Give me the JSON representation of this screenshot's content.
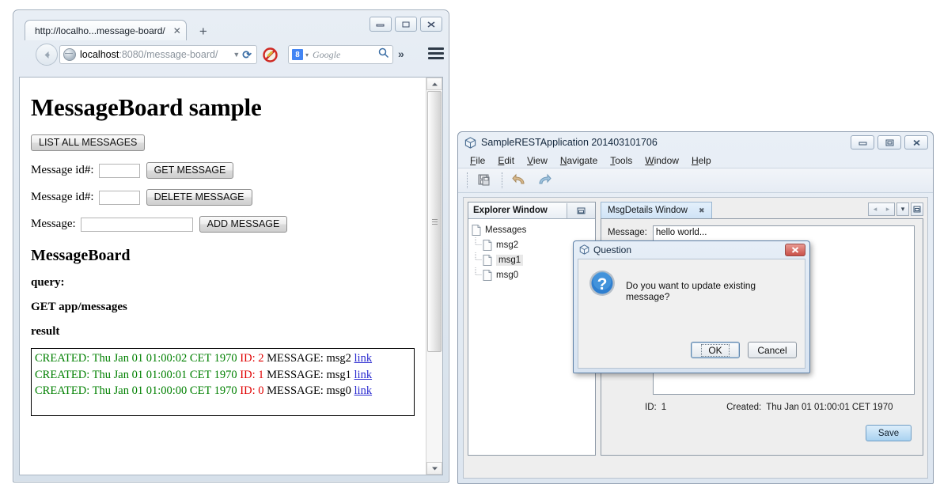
{
  "browser": {
    "tab": {
      "label": "http://localho...message-board/",
      "close": "✕",
      "new_tab": "+"
    },
    "window_buttons": {
      "minimize": "minimize-icon",
      "maximize": "maximize-icon",
      "close": "close-icon"
    },
    "url": {
      "host": "localhost",
      "path": ":8080/message-board/",
      "dropdown": "▼",
      "reload": "⟳"
    },
    "search": {
      "engine_badge": "8",
      "caret": "▾",
      "placeholder_text": "Google",
      "magnifier": "search-icon"
    },
    "overflow": "»",
    "menu": "hamburger-menu-icon",
    "noscript": "noscript-blocked-icon"
  },
  "page": {
    "title": "MessageBoard sample",
    "list_all_button": "LIST ALL MESSAGES",
    "rows": [
      {
        "label": "Message id#:",
        "value": "",
        "button": "GET MESSAGE",
        "wide": false
      },
      {
        "label": "Message id#:",
        "value": "",
        "button": "DELETE MESSAGE",
        "wide": false
      },
      {
        "label": "Message:",
        "value": "",
        "button": "ADD MESSAGE",
        "wide": true
      }
    ],
    "section_title": "MessageBoard",
    "query_label": "query:",
    "query_value": "GET app/messages",
    "result_label": "result",
    "results": [
      {
        "created_label": "CREATED:",
        "created": "Thu Jan 01 01:00:02 CET 1970",
        "id_label": "ID:",
        "id": "2",
        "message_label": "MESSAGE:",
        "message": "msg2",
        "link": "link"
      },
      {
        "created_label": "CREATED:",
        "created": "Thu Jan 01 01:00:01 CET 1970",
        "id_label": "ID:",
        "id": "1",
        "message_label": "MESSAGE:",
        "message": "msg1",
        "link": "link"
      },
      {
        "created_label": "CREATED:",
        "created": "Thu Jan 01 01:00:00 CET 1970",
        "id_label": "ID:",
        "id": "0",
        "message_label": "MESSAGE:",
        "message": "msg0",
        "link": "link"
      }
    ],
    "colors": {
      "created": "#008000",
      "id": "#e00000",
      "link": "#2a2ad0"
    }
  },
  "app": {
    "title": "SampleRESTApplication 201403101706",
    "menus": [
      {
        "pre": "",
        "mnemonic": "F",
        "post": "ile"
      },
      {
        "pre": "",
        "mnemonic": "E",
        "post": "dit"
      },
      {
        "pre": "",
        "mnemonic": "V",
        "post": "iew"
      },
      {
        "pre": "",
        "mnemonic": "N",
        "post": "avigate"
      },
      {
        "pre": "",
        "mnemonic": "T",
        "post": "ools"
      },
      {
        "pre": "",
        "mnemonic": "W",
        "post": "indow"
      },
      {
        "pre": "",
        "mnemonic": "H",
        "post": "elp"
      }
    ],
    "toolbar": [
      "save-all-icon",
      "undo-icon",
      "redo-icon"
    ],
    "explorer": {
      "title": "Explorer Window",
      "minimize": "▭",
      "root": "Messages",
      "children": [
        {
          "label": "msg2",
          "selected": false
        },
        {
          "label": "msg1",
          "selected": true
        },
        {
          "label": "msg0",
          "selected": false
        }
      ]
    },
    "editor": {
      "tab_label": "MsgDetails Window",
      "tab_close": "✖",
      "message_label": "Message:",
      "message_value": "hello world...",
      "id_label": "ID:",
      "id_value": "1",
      "created_label": "Created:",
      "created_value": "Thu Jan 01 01:00:01 CET 1970",
      "save_label": "Save",
      "nav_prev": "◂",
      "nav_next": "▸",
      "nav_dropdown": "▾",
      "nav_maximize": "▭"
    }
  },
  "dialog": {
    "title": "Question",
    "icon": "question-icon",
    "message": "Do you want to update existing message?",
    "ok_label": "OK",
    "cancel_label": "Cancel",
    "close": "✕"
  }
}
